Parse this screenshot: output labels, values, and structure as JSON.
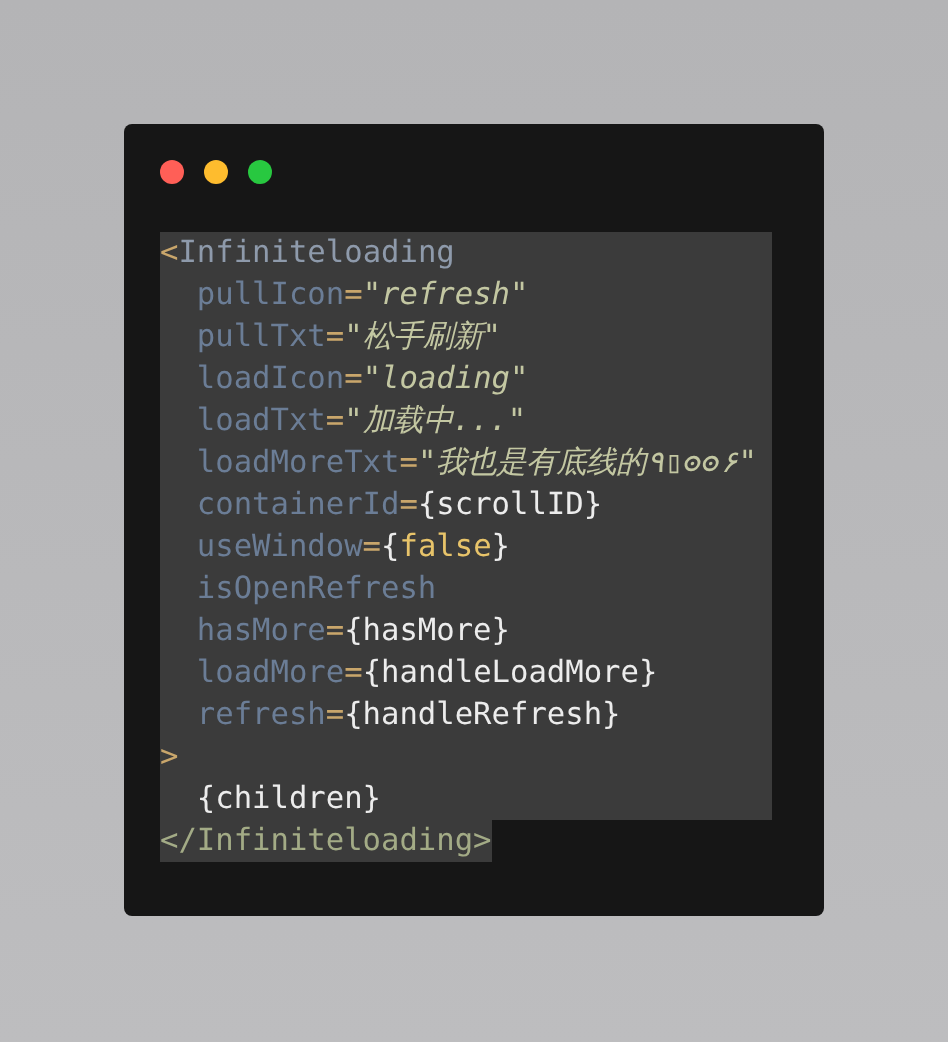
{
  "window": {
    "controls": [
      {
        "color": "#ff5f57"
      },
      {
        "color": "#febc2e"
      },
      {
        "color": "#28c840"
      }
    ]
  },
  "code": {
    "lines": [
      {
        "selected": true,
        "selected_past_end": true,
        "indented": false,
        "tokens": [
          {
            "kind": "punct",
            "text": "<"
          },
          {
            "kind": "tag",
            "text": "Infiniteloading"
          }
        ]
      },
      {
        "selected": true,
        "selected_past_end": true,
        "indented": true,
        "tokens": [
          {
            "kind": "attr",
            "text": "pullIcon"
          },
          {
            "kind": "punct",
            "text": "="
          },
          {
            "kind": "string",
            "text": "\"refresh\""
          }
        ]
      },
      {
        "selected": true,
        "selected_past_end": true,
        "indented": true,
        "tokens": [
          {
            "kind": "attr",
            "text": "pullTxt"
          },
          {
            "kind": "punct",
            "text": "="
          },
          {
            "kind": "string",
            "text": "\"松手刷新\""
          }
        ]
      },
      {
        "selected": true,
        "selected_past_end": true,
        "indented": true,
        "tokens": [
          {
            "kind": "attr",
            "text": "loadIcon"
          },
          {
            "kind": "punct",
            "text": "="
          },
          {
            "kind": "string",
            "text": "\"loading\""
          }
        ]
      },
      {
        "selected": true,
        "selected_past_end": true,
        "indented": true,
        "tokens": [
          {
            "kind": "attr",
            "text": "loadTxt"
          },
          {
            "kind": "punct",
            "text": "="
          },
          {
            "kind": "string",
            "text": "\"加载中...\""
          }
        ]
      },
      {
        "selected": true,
        "selected_past_end": true,
        "indented": true,
        "tokens": [
          {
            "kind": "attr",
            "text": "loadMoreTxt"
          },
          {
            "kind": "punct",
            "text": "="
          },
          {
            "kind": "string",
            "text": "\"我也是有底线的٩▯ʘʘ۶\""
          }
        ]
      },
      {
        "selected": true,
        "selected_past_end": true,
        "indented": true,
        "tokens": [
          {
            "kind": "attr",
            "text": "containerId"
          },
          {
            "kind": "punct",
            "text": "="
          },
          {
            "kind": "expr",
            "text": "{scrollID}"
          }
        ]
      },
      {
        "selected": true,
        "selected_past_end": true,
        "indented": true,
        "tokens": [
          {
            "kind": "attr",
            "text": "useWindow"
          },
          {
            "kind": "punct",
            "text": "="
          },
          {
            "kind": "expr",
            "text": "{"
          },
          {
            "kind": "keyword",
            "text": "false"
          },
          {
            "kind": "expr",
            "text": "}"
          }
        ]
      },
      {
        "selected": true,
        "selected_past_end": true,
        "indented": true,
        "tokens": [
          {
            "kind": "attr",
            "text": "isOpenRefresh"
          }
        ]
      },
      {
        "selected": true,
        "selected_past_end": true,
        "indented": true,
        "tokens": [
          {
            "kind": "attr",
            "text": "hasMore"
          },
          {
            "kind": "punct",
            "text": "="
          },
          {
            "kind": "expr",
            "text": "{hasMore}"
          }
        ]
      },
      {
        "selected": true,
        "selected_past_end": true,
        "indented": true,
        "tokens": [
          {
            "kind": "attr",
            "text": "loadMore"
          },
          {
            "kind": "punct",
            "text": "="
          },
          {
            "kind": "expr",
            "text": "{handleLoadMore}"
          }
        ]
      },
      {
        "selected": true,
        "selected_past_end": true,
        "indented": true,
        "tokens": [
          {
            "kind": "attr",
            "text": "refresh"
          },
          {
            "kind": "punct",
            "text": "="
          },
          {
            "kind": "expr",
            "text": "{handleRefresh}"
          }
        ]
      },
      {
        "selected": true,
        "selected_past_end": true,
        "indented": false,
        "tokens": [
          {
            "kind": "punct",
            "text": ">"
          }
        ]
      },
      {
        "selected": true,
        "selected_past_end": true,
        "indented": true,
        "tokens": [
          {
            "kind": "expr",
            "text": "{children}"
          }
        ]
      },
      {
        "selected": true,
        "selected_past_end": false,
        "indented": false,
        "tokens": [
          {
            "kind": "closetag",
            "text": "</Infiniteloading>"
          }
        ]
      }
    ]
  }
}
